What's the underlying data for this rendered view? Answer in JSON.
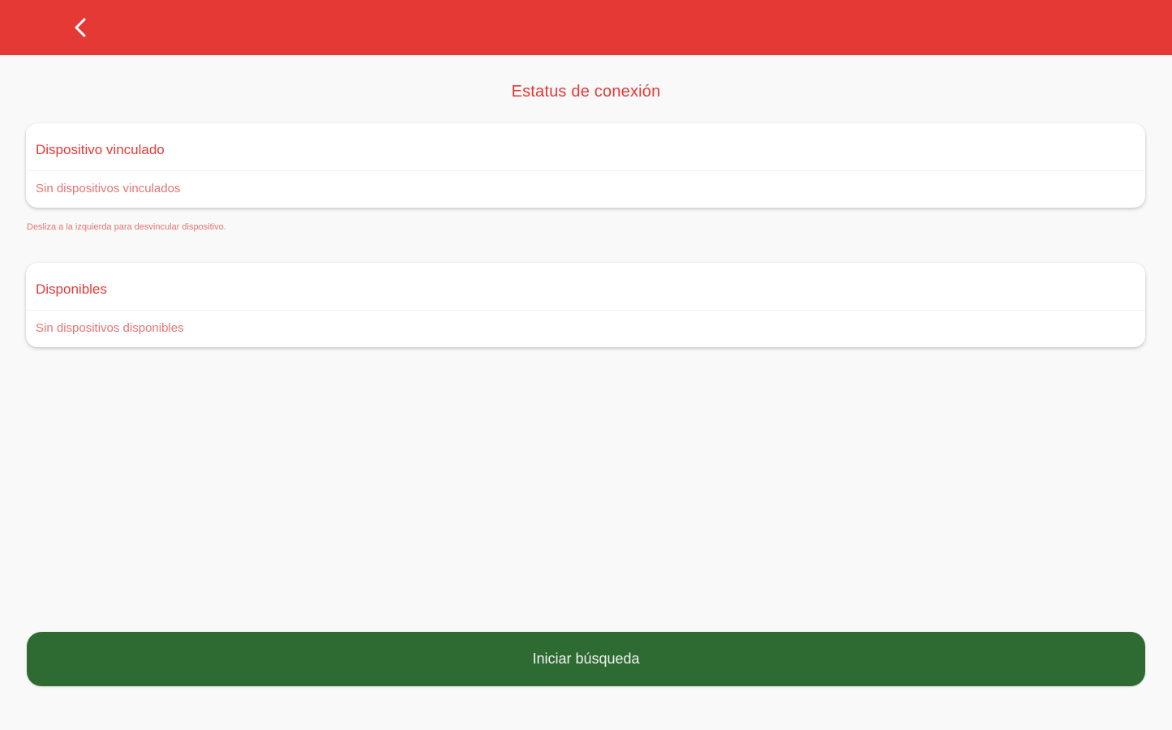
{
  "colors": {
    "accent": "#e53935",
    "accent_light": "#e57373",
    "button_green": "#2e6b33",
    "background": "#f9f9f9"
  },
  "header": {
    "back_icon": "chevron-left-icon"
  },
  "title": "Estatus de conexión",
  "linked_card": {
    "header": "Dispositivo vinculado",
    "empty_text": "Sin dispositivos vinculados"
  },
  "hint": "Desliza a la izquierda para desvincular dispositivo.",
  "available_card": {
    "header": "Disponibles",
    "empty_text": "Sin dispositivos disponibles"
  },
  "search_button": {
    "label": "Iniciar búsqueda"
  }
}
